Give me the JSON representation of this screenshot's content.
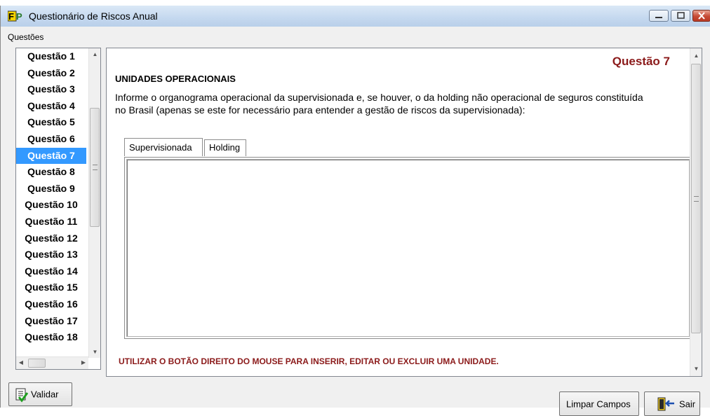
{
  "window": {
    "title": "Questionário de Riscos Anual"
  },
  "group": {
    "label": "Questões"
  },
  "questions": [
    "Questão 1",
    "Questão 2",
    "Questão 3",
    "Questão 4",
    "Questão 5",
    "Questão 6",
    "Questão 7",
    "Questão 8",
    "Questão 9",
    "Questão 10",
    "Questão 11",
    "Questão 12",
    "Questão 13",
    "Questão 14",
    "Questão 15",
    "Questão 16",
    "Questão 17",
    "Questão 18"
  ],
  "selected_question": "Questão 7",
  "main": {
    "question_title": "Questão 7",
    "section_title": "UNIDADES OPERACIONAIS",
    "description": "Informe o organograma operacional da supervisionada e, se houver, o da holding não operacional de seguros constituída no Brasil (apenas se este for necessário para entender a gestão de riscos da supervisionada):",
    "tabs": [
      "Supervisionada",
      "Holding"
    ],
    "hint": "UTILIZAR O BOTÃO DIREITO DO MOUSE PARA INSERIR, EDITAR OU EXCLUIR UMA UNIDADE."
  },
  "buttons": {
    "validar": "Validar",
    "limpar": "Limpar Campos",
    "sair": "Sair"
  },
  "colors": {
    "accent_selected": "#3399ff",
    "question_title": "#8b1a1a",
    "hint": "#8b1a1a"
  }
}
